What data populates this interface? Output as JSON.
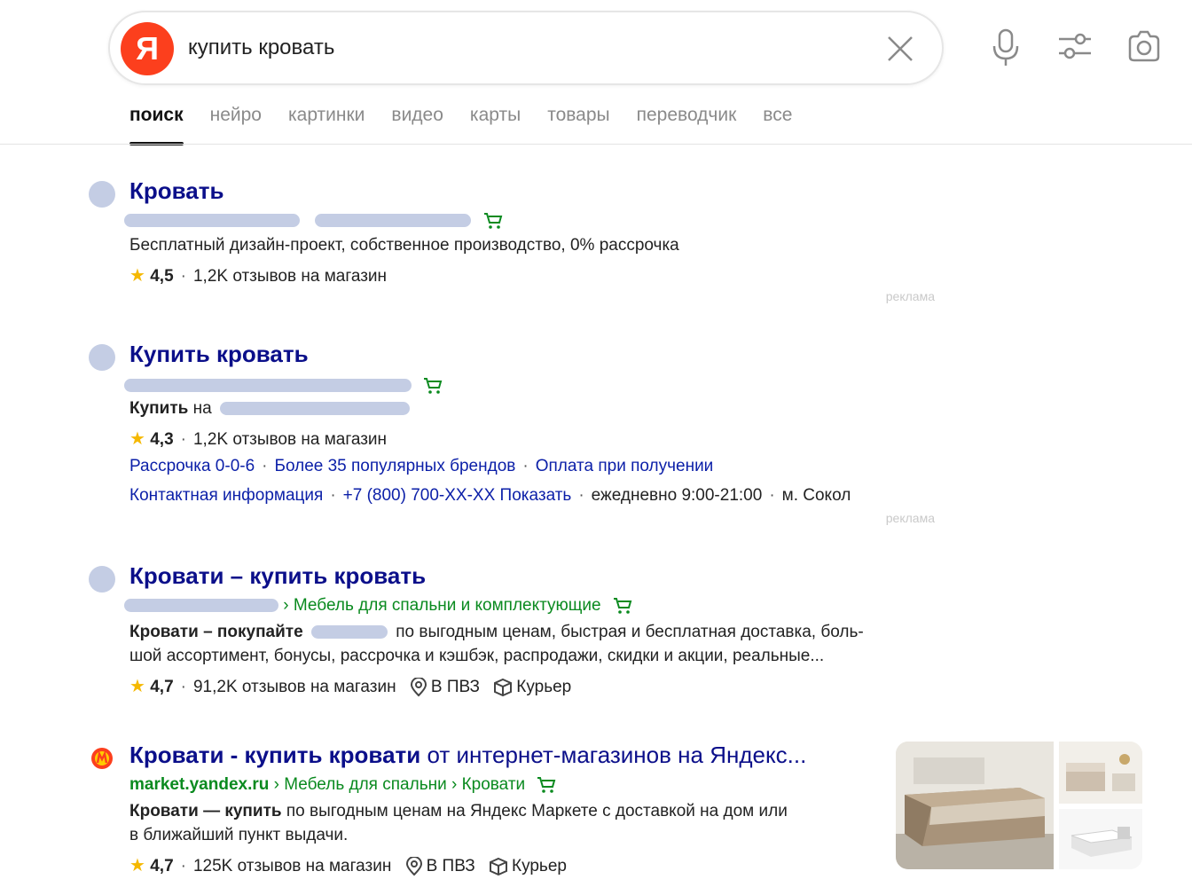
{
  "search": {
    "logo_letter": "Я",
    "query": "купить кровать"
  },
  "tabs": [
    "поиск",
    "нейро",
    "картинки",
    "видео",
    "карты",
    "товары",
    "переводчик",
    "все"
  ],
  "results": [
    {
      "title": "Кровать",
      "description": "Бесплатный дизайн-проект, собственное производство, 0% рассрочка",
      "rating": "4,5",
      "reviews": "1,2K отзывов на магазин",
      "ad_label": "реклама"
    },
    {
      "title": "Купить кровать",
      "desc_bold": "Купить",
      "desc_rest": "на",
      "rating": "4,3",
      "reviews": "1,2K отзывов на магазин",
      "sitelinks1": [
        "Рассрочка 0-0-6",
        "Более 35 популярных брендов",
        "Оплата при получении"
      ],
      "contact_label": "Контактная информация",
      "phone": "+7 (800) 700-XX-XX Показать",
      "hours": "ежедневно 9:00-21:00",
      "metro": "м. Сокол",
      "ad_label": "реклама"
    },
    {
      "title": "Кровати – купить кровать",
      "breadcrumb": "› Мебель для спальни и комплектующие",
      "desc_bold": "Кровати – покупайте",
      "desc_rest1": "по выгодным ценам, быстрая и бесплатная доставка, боль-",
      "desc_line2": "шой ассортимент, бонусы, рассрочка и кэшбэк, распродажи, скидки и акции, реальные...",
      "rating": "4,7",
      "reviews": "91,2K отзывов на магазин",
      "pickup": "В ПВЗ",
      "courier": "Курьер"
    },
    {
      "title_bold": "Кровати - купить кровати",
      "title_rest": "от интернет-магазинов на Яндекс...",
      "breadcrumb_domain": "market.yandex.ru",
      "breadcrumb_rest": "› Мебель для спальни › Кровати",
      "desc_bold": "Кровати — купить",
      "desc_rest": "по выгодным ценам на Яндекс Маркете с доставкой на дом или",
      "desc_line2": "в ближайший пункт выдачи.",
      "rating": "4,7",
      "reviews": "125K отзывов на магазин",
      "pickup": "В ПВЗ",
      "courier": "Курьер"
    }
  ],
  "colors": {
    "link": "#0b0f8a",
    "green": "#0a8a1f",
    "brand": "#fc3f1d",
    "star": "#f5b800"
  }
}
